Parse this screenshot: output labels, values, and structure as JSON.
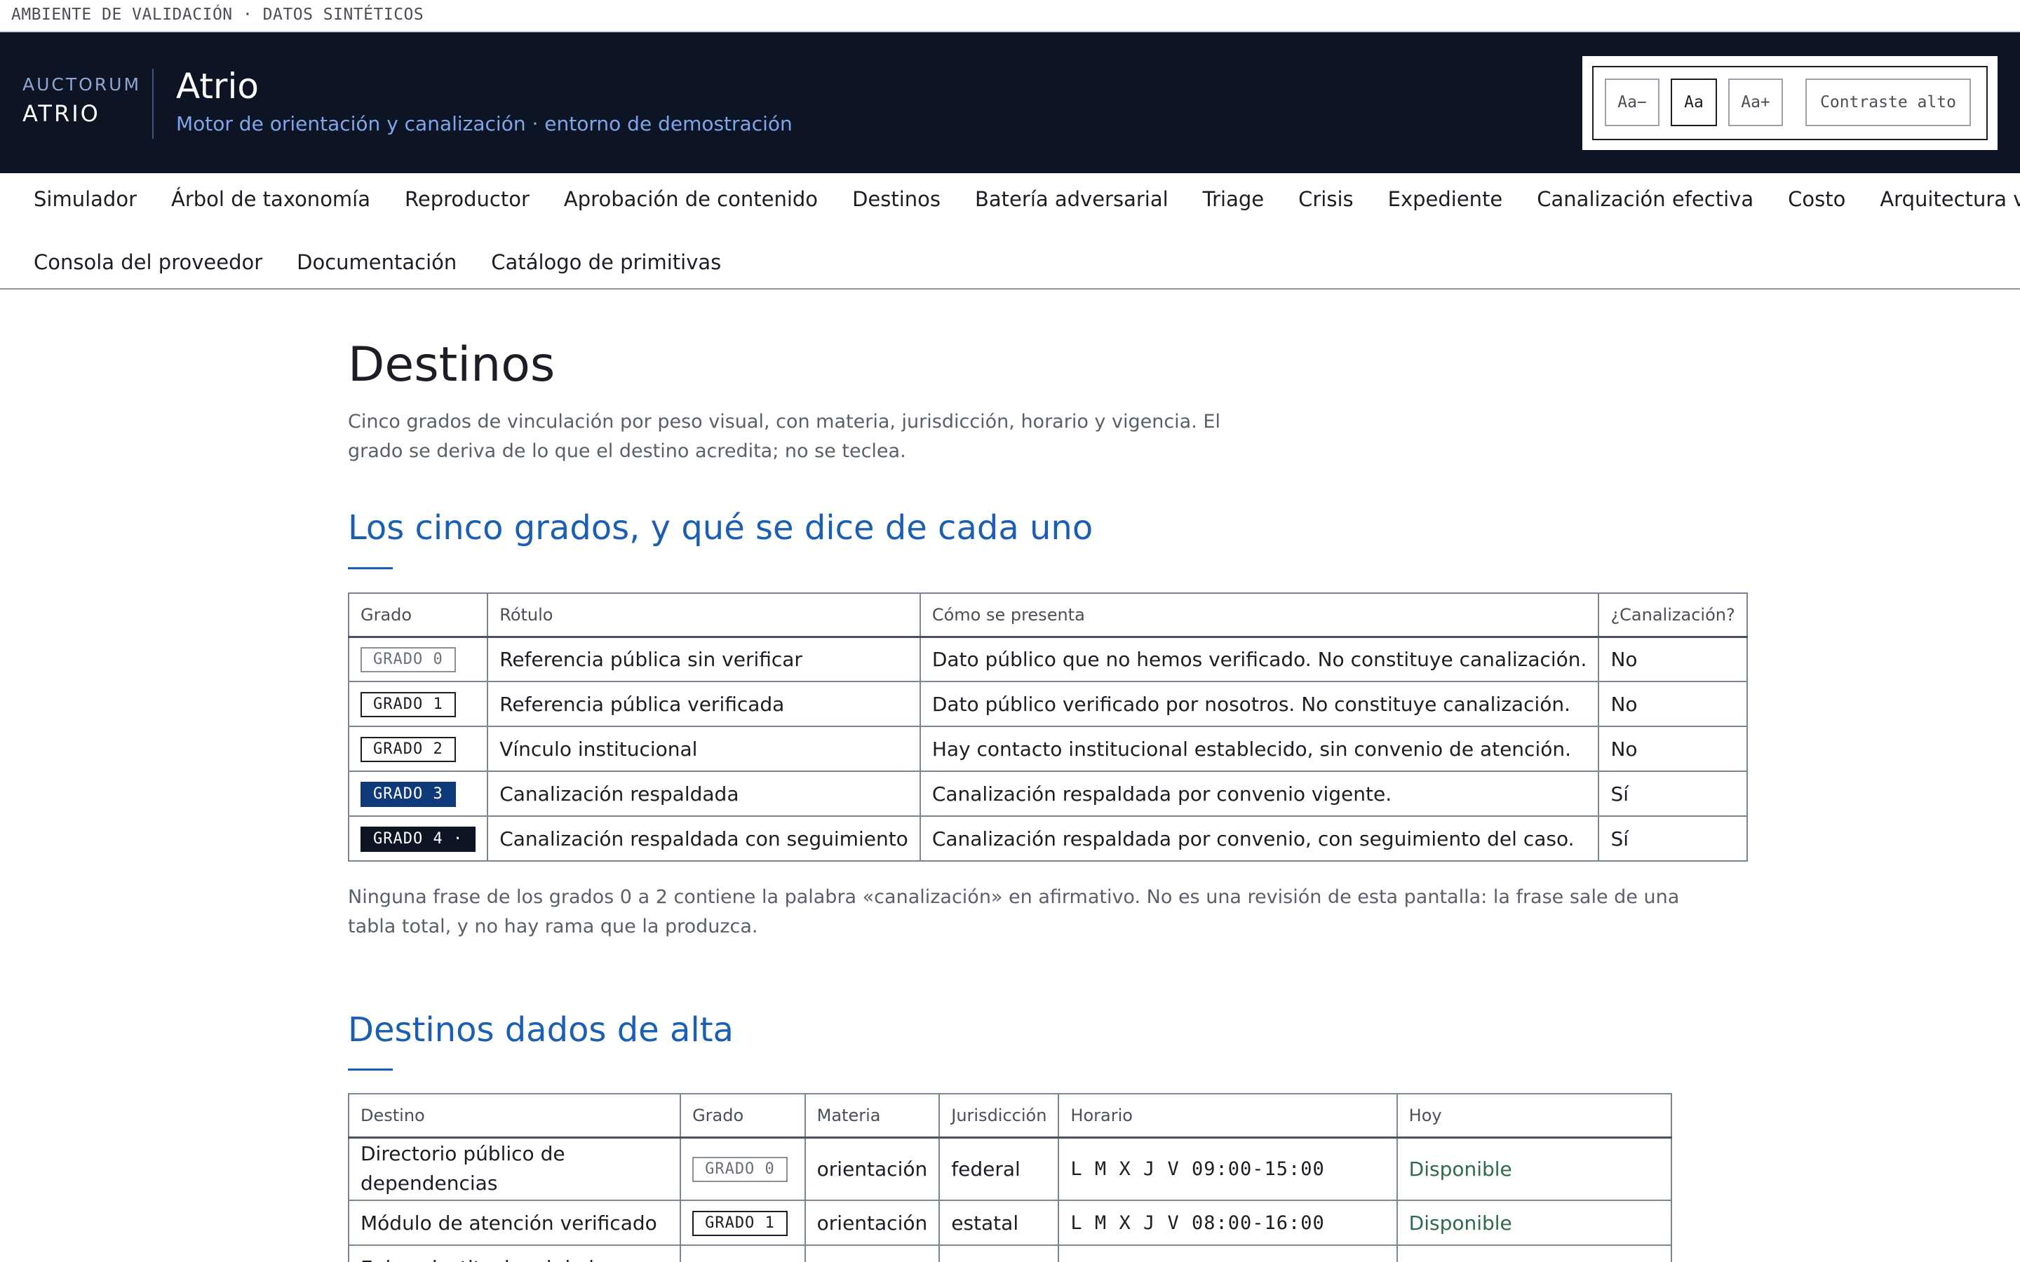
{
  "env_banner": "AMBIENTE DE VALIDACIÓN · DATOS SINTÉTICOS",
  "header": {
    "brand_top": "AUCTORUM",
    "brand_bottom": "ATRIO",
    "title": "Atrio",
    "subtitle": "Motor de orientación y canalización · entorno de demostración",
    "a11y": {
      "font_smaller": "Aa−",
      "font_normal": "Aa",
      "font_larger": "Aa+",
      "high_contrast": "Contraste alto"
    }
  },
  "nav": {
    "row1": [
      "Simulador",
      "Árbol de taxonomía",
      "Reproductor",
      "Aprobación de contenido",
      "Destinos",
      "Batería adversarial",
      "Triage",
      "Crisis",
      "Expediente",
      "Canalización efectiva",
      "Costo",
      "Arquitectura viva"
    ],
    "row2": [
      "Consola del proveedor",
      "Documentación",
      "Catálogo de primitivas"
    ]
  },
  "page": {
    "title": "Destinos",
    "intro": "Cinco grados de vinculación por peso visual, con materia, jurisdicción, horario y vigencia. El grado se deriva de lo que el destino acredita; no se teclea."
  },
  "grades_section": {
    "title": "Los cinco grados, y qué se dice de cada uno",
    "headers": [
      "Grado",
      "Rótulo",
      "Cómo se presenta",
      "¿Canalización?"
    ],
    "rows": [
      {
        "badge": "GRADO 0",
        "label": "Referencia pública sin verificar",
        "presentation": "Dato público que no hemos verificado. No constituye canalización.",
        "channel": "No"
      },
      {
        "badge": "GRADO 1",
        "label": "Referencia pública verificada",
        "presentation": "Dato público verificado por nosotros. No constituye canalización.",
        "channel": "No"
      },
      {
        "badge": "GRADO 2",
        "label": "Vínculo institucional",
        "presentation": "Hay contacto institucional establecido, sin convenio de atención.",
        "channel": "No"
      },
      {
        "badge": "GRADO 3",
        "label": "Canalización respaldada",
        "presentation": "Canalización respaldada por convenio vigente.",
        "channel": "Sí"
      },
      {
        "badge": "GRADO 4 ·",
        "label": "Canalización respaldada con seguimiento",
        "presentation": "Canalización respaldada por convenio, con seguimiento del caso.",
        "channel": "Sí"
      }
    ],
    "note": "Ninguna frase de los grados 0 a 2 contiene la palabra «canalización» en afirmativo. No es una revisión de esta pantalla: la frase sale de una tabla total, y no hay rama que la produzca."
  },
  "destinations_section": {
    "title": "Destinos dados de alta",
    "headers": [
      "Destino",
      "Grado",
      "Materia",
      "Jurisdicción",
      "Horario",
      "Hoy"
    ],
    "rows": [
      {
        "name": "Directorio público de dependencias",
        "badge": "GRADO 0",
        "subject": "orientación",
        "jurisdiction": "federal",
        "schedule": "L M X J V 09:00-15:00",
        "today": "Disponible"
      },
      {
        "name": "Módulo de atención verificado",
        "badge": "GRADO 1",
        "subject": "orientación",
        "jurisdiction": "estatal",
        "schedule": "L M X J V 08:00-16:00",
        "today": "Disponible"
      },
      {
        "name": "Enlace institucional de la",
        "badge": "",
        "subject": "",
        "jurisdiction": "",
        "schedule": "",
        "today": ""
      }
    ]
  },
  "colors": {
    "header_bg": "#0d1424",
    "accent": "#1a5fb4",
    "grade3": "#0f3a7a",
    "grade4": "#0d1424",
    "available": "#2e6b4a"
  }
}
